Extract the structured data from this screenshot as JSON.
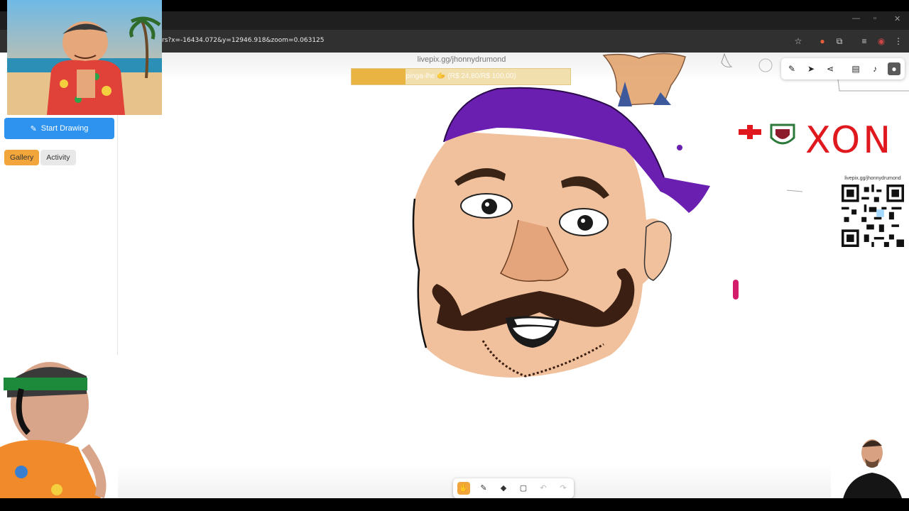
{
  "browser": {
    "url": "rs?x=-16434.072&y=12946.918&zoom=0.063125",
    "icons": [
      "star-icon",
      "extension-icon",
      "puzzle-icon",
      "media-icon",
      "profile-icon",
      "menu-icon"
    ]
  },
  "canvas": {
    "live_url": "livepix.gg/jhonnydrumond",
    "goal": {
      "text": "pinga-lhe 🫱 (R$ 24,80/R$ 100,00)",
      "progress_percent": 24.8
    },
    "tools_top": [
      "pencil-icon",
      "cursor-icon",
      "share-icon",
      "chat-icon",
      "bell-icon",
      "profile-icon"
    ],
    "painted_text": "XON",
    "qr_label": "livepix.gg/jhonnydrumond"
  },
  "sidebar": {
    "start_drawing_label": "Start Drawing",
    "tabs": [
      {
        "label": "Gallery",
        "active": true
      },
      {
        "label": "Activity",
        "active": false
      }
    ]
  },
  "bottom_toolbar": {
    "tools": [
      "hand-icon",
      "pencil-icon",
      "eraser-icon",
      "rectangle-icon",
      "undo-icon",
      "redo-icon"
    ],
    "active": "hand-icon"
  },
  "colors": {
    "accent_orange": "#f2a53a",
    "button_blue": "#2d93ee",
    "bandana_purple": "#6a1fb0",
    "xon_red": "#e0191e"
  }
}
